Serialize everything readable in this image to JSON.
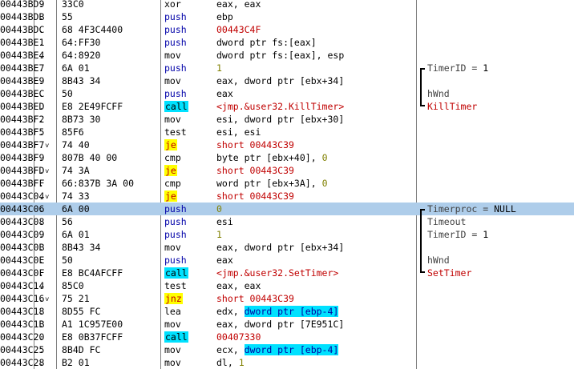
{
  "colors": {
    "selection": "#aecdea",
    "call_highlight": "#00e1ff",
    "jump_highlight": "#ffff00",
    "jump_text": "#c00000",
    "push_text": "#0000a8",
    "number_text": "#808000",
    "api_comment_text": "#c00000"
  },
  "rows": [
    {
      "addr": "00443BD9",
      "mark": ".",
      "hex": "33C0",
      "mnemonic": "xor",
      "operand": "eax, eax",
      "comment": ""
    },
    {
      "addr": "00443BDB",
      "mark": ".",
      "hex": "55",
      "mnemonic": "push",
      "operand": "ebp",
      "comment": ""
    },
    {
      "addr": "00443BDC",
      "mark": ".",
      "hex": "68 4F3C4400",
      "mnemonic": "push",
      "operand": "00443C4F",
      "comment": ""
    },
    {
      "addr": "00443BE1",
      "mark": ".",
      "hex": "64:FF30",
      "mnemonic": "push",
      "operand": "dword ptr fs:[eax]",
      "comment": ""
    },
    {
      "addr": "00443BE4",
      "mark": ".",
      "hex": "64:8920",
      "mnemonic": "mov",
      "operand": "dword ptr fs:[eax], esp",
      "comment": ""
    },
    {
      "addr": "00443BE7",
      "mark": ".",
      "hex": "6A 01",
      "mnemonic": "push",
      "operand": "1",
      "comment": "TimerID = 1"
    },
    {
      "addr": "00443BE9",
      "mark": ".",
      "hex": "8B43 34",
      "mnemonic": "mov",
      "operand": "eax, dword ptr [ebx+34]",
      "comment": ""
    },
    {
      "addr": "00443BEC",
      "mark": ".",
      "hex": "50",
      "mnemonic": "push",
      "operand": "eax",
      "comment": "hWnd"
    },
    {
      "addr": "00443BED",
      "mark": ".",
      "hex": "E8 2E49FCFF",
      "mnemonic": "call",
      "operand": "<jmp.&user32.KillTimer>",
      "comment": "KillTimer"
    },
    {
      "addr": "00443BF2",
      "mark": ".",
      "hex": "8B73 30",
      "mnemonic": "mov",
      "operand": "esi, dword ptr [ebx+30]",
      "comment": ""
    },
    {
      "addr": "00443BF5",
      "mark": ".",
      "hex": "85F6",
      "mnemonic": "test",
      "operand": "esi, esi",
      "comment": ""
    },
    {
      "addr": "00443BF7",
      "mark": ".",
      "hex": "74 40",
      "mnemonic": "je",
      "operand": "short 00443C39",
      "comment": ""
    },
    {
      "addr": "00443BF9",
      "mark": ".",
      "hex": "807B 40 00",
      "mnemonic": "cmp",
      "operand": "byte ptr [ebx+40], 0",
      "comment": ""
    },
    {
      "addr": "00443BFD",
      "mark": ".",
      "hex": "74 3A",
      "mnemonic": "je",
      "operand": "short 00443C39",
      "comment": ""
    },
    {
      "addr": "00443BFF",
      "mark": ".",
      "hex": "66:837B 3A 00",
      "mnemonic": "cmp",
      "operand": "word ptr [ebx+3A], 0",
      "comment": ""
    },
    {
      "addr": "00443C04",
      "mark": ".",
      "hex": "74 33",
      "mnemonic": "je",
      "operand": "short 00443C39",
      "comment": ""
    },
    {
      "addr": "00443C06",
      "mark": ".",
      "hex": "6A 00",
      "mnemonic": "push",
      "operand": "0",
      "comment": "Timerproc = NULL"
    },
    {
      "addr": "00443C08",
      "mark": ".",
      "hex": "56",
      "mnemonic": "push",
      "operand": "esi",
      "comment": "Timeout"
    },
    {
      "addr": "00443C09",
      "mark": ".",
      "hex": "6A 01",
      "mnemonic": "push",
      "operand": "1",
      "comment": "TimerID = 1"
    },
    {
      "addr": "00443C0B",
      "mark": ".",
      "hex": "8B43 34",
      "mnemonic": "mov",
      "operand": "eax, dword ptr [ebx+34]",
      "comment": ""
    },
    {
      "addr": "00443C0E",
      "mark": ".",
      "hex": "50",
      "mnemonic": "push",
      "operand": "eax",
      "comment": "hWnd"
    },
    {
      "addr": "00443C0F",
      "mark": ".",
      "hex": "E8 BC4AFCFF",
      "mnemonic": "call",
      "operand": "<jmp.&user32.SetTimer>",
      "comment": "SetTimer"
    },
    {
      "addr": "00443C14",
      "mark": ".",
      "hex": "85C0",
      "mnemonic": "test",
      "operand": "eax, eax",
      "comment": ""
    },
    {
      "addr": "00443C16",
      "mark": ".",
      "hex": "75 21",
      "mnemonic": "jnz",
      "operand": "short 00443C39",
      "comment": ""
    },
    {
      "addr": "00443C18",
      "mark": ".",
      "hex": "8D55 FC",
      "mnemonic": "lea",
      "operand": "edx, dword ptr [ebp-4]",
      "comment": ""
    },
    {
      "addr": "00443C1B",
      "mark": ".",
      "hex": "A1 1C957E00",
      "mnemonic": "mov",
      "operand": "eax, dword ptr [7E951C]",
      "comment": ""
    },
    {
      "addr": "00443C20",
      "mark": ".",
      "hex": "E8 0B37FCFF",
      "mnemonic": "call",
      "operand": "00407330",
      "comment": ""
    },
    {
      "addr": "00443C25",
      "mark": ".",
      "hex": "8B4D FC",
      "mnemonic": "mov",
      "operand": "ecx, dword ptr [ebp-4]",
      "comment": ""
    },
    {
      "addr": "00443C28",
      "mark": ".",
      "hex": "B2 01",
      "mnemonic": "mov",
      "operand": "dl, 1",
      "comment": ""
    }
  ],
  "selected_addr": "00443C06"
}
